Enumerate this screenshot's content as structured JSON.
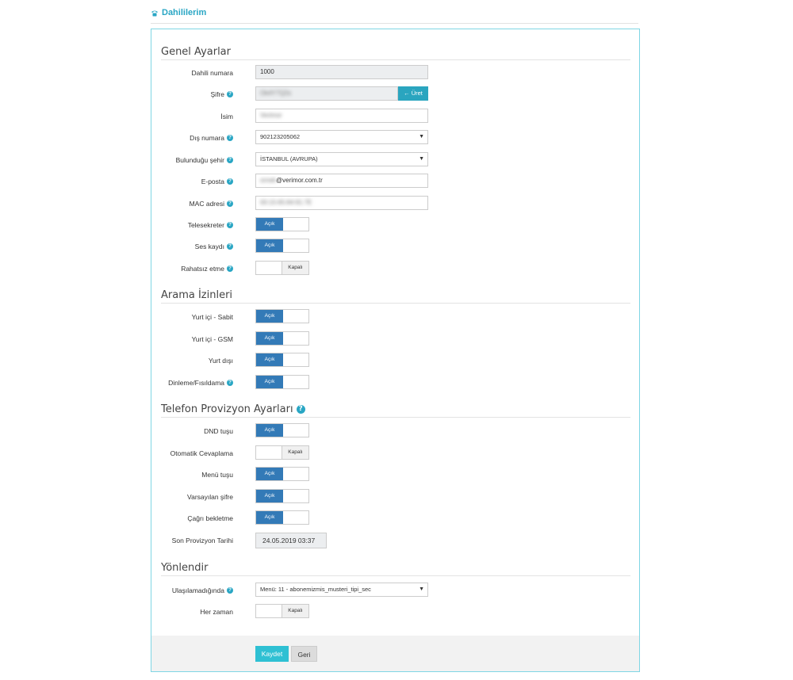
{
  "header": {
    "title": "Dahililerim",
    "icon": "phone-icon"
  },
  "sections": {
    "genel": "Genel Ayarlar",
    "arama": "Arama İzinleri",
    "provizyon": "Telefon Provizyon Ayarları",
    "yonlendir": "Yönlendir"
  },
  "genel": {
    "dahili_label": "Dahili numara",
    "dahili_value": "1000",
    "sifre_label": "Şifre",
    "sifre_value": "Ok4Y7Q2s",
    "urec_label": "Üret",
    "isim_label": "İsim",
    "isim_value": "Verimor",
    "dis_label": "Dış numara",
    "dis_value": "902123205062",
    "sehir_label": "Bulunduğu şehir",
    "sehir_value": "İSTANBUL (AVRUPA)",
    "eposta_label": "E-posta",
    "eposta_user": "ornek",
    "eposta_domain": "@verimor.com.tr",
    "mac_label": "MAC adresi",
    "mac_value": "00:15:65:84:91:7E",
    "telesekreter_label": "Telesekreter",
    "ses_label": "Ses kaydı",
    "rahatsiz_label": "Rahatsız etme"
  },
  "arama": {
    "sabit_label": "Yurt içi - Sabit",
    "gsm_label": "Yurt içi - GSM",
    "yurtdisi_label": "Yurt dışı",
    "dinleme_label": "Dinleme/Fısıldama"
  },
  "provizyon": {
    "dnd_label": "DND tuşu",
    "otomatik_label": "Otomatik Cevaplama",
    "menu_label": "Menü tuşu",
    "varsayilan_label": "Varsayılan şifre",
    "cagri_label": "Çağrı bekletme",
    "son_label": "Son Provizyon Tarihi",
    "son_value": "24.05.2019 03:37"
  },
  "yonlendir": {
    "ulasilamadiginda_label": "Ulaşılamadığında",
    "ulasilamadiginda_value": "Menü: 11 - abonemizmis_musteri_tipi_sec",
    "herzaman_label": "Her zaman"
  },
  "toggles": {
    "on": "Açık",
    "off": "Kapalı"
  },
  "footer": {
    "save": "Kaydet",
    "back": "Geri"
  },
  "colors": {
    "accent": "#29a6c4",
    "toggle_on": "#337ab7",
    "save": "#2fc0d3"
  }
}
